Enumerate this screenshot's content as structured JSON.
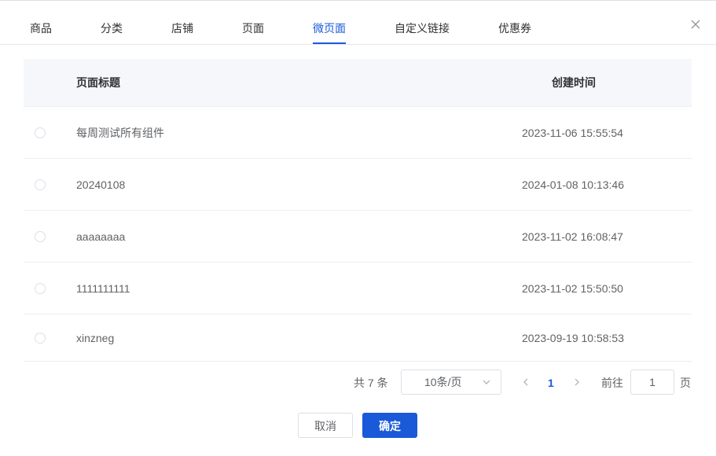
{
  "tabs": [
    {
      "label": "商品",
      "active": false
    },
    {
      "label": "分类",
      "active": false
    },
    {
      "label": "店铺",
      "active": false
    },
    {
      "label": "页面",
      "active": false
    },
    {
      "label": "微页面",
      "active": true
    },
    {
      "label": "自定义链接",
      "active": false
    },
    {
      "label": "优惠券",
      "active": false
    }
  ],
  "close_icon": "close-icon",
  "table": {
    "columns": [
      "页面标题",
      "创建时间"
    ],
    "rows": [
      {
        "title": "每周测试所有组件",
        "created": "2023-11-06 15:55:54",
        "selected": false
      },
      {
        "title": "20240108",
        "created": "2024-01-08 10:13:46",
        "selected": false
      },
      {
        "title": "aaaaaaaa",
        "created": "2023-11-02 16:08:47",
        "selected": false
      },
      {
        "title": "1111111111",
        "created": "2023-11-02 15:50:50",
        "selected": false
      },
      {
        "title": "xinzneg",
        "created": "2023-09-19 10:58:53",
        "selected": false
      }
    ]
  },
  "pagination": {
    "total": "共 7 条",
    "page_size": "10条/页",
    "current_page": "1",
    "goto_label": "前往",
    "goto_value": "1",
    "goto_suffix": "页",
    "prev_icon": "chevron-left-icon",
    "next_icon": "chevron-right-icon",
    "size_icon": "chevron-down-icon"
  },
  "footer": {
    "cancel_label": "取消",
    "ok_label": "确定"
  },
  "colors": {
    "accent": "#1a5ad8",
    "header_bg": "#f5f7fa",
    "border": "#ebeef5",
    "text": "#606266"
  }
}
